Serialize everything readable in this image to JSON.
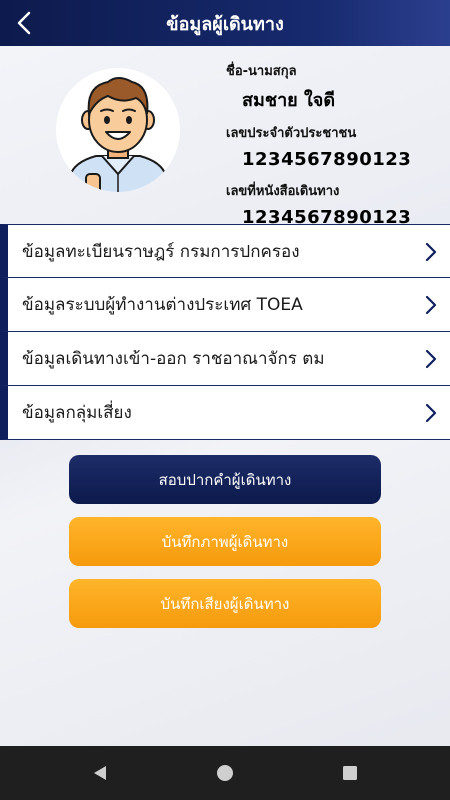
{
  "header": {
    "title": "ข้อมูลผู้เดินทาง"
  },
  "profile": {
    "name_label": "ชื่อ-นามสกุล",
    "name_value": "สมชาย ใจดี",
    "id_label": "เลขประจำตัวประชาชน",
    "id_value": "1234567890123",
    "passport_label": "เลขที่หนังสือเดินทาง",
    "passport_value": "1234567890123"
  },
  "menu": {
    "items": [
      {
        "label": "ข้อมูลทะเบียนราษฎร์ กรมการปกครอง"
      },
      {
        "label": "ข้อมูลระบบผู้ทำงานต่างประเทศ TOEA"
      },
      {
        "label": "ข้อมูลเดินทางเข้า-ออก ราชอาณาจักร ตม"
      },
      {
        "label": "ข้อมูลกลุ่มเสี่ยง"
      }
    ]
  },
  "actions": {
    "interview_label": "สอบปากคำผู้เดินทาง",
    "photo_label": "บันทึกภาพผู้เดินทาง",
    "audio_label": "บันทึกเสียงผู้เดินทาง"
  },
  "colors": {
    "primary": "#0f1f5e",
    "accent": "#f8a318",
    "navbar": "#1f1f1f"
  },
  "icons": {
    "back": "chevron-left-icon",
    "menu_arrow": "chevron-right-icon",
    "avatar": "man-avatar-icon",
    "nav": [
      "nav-back-icon",
      "nav-home-icon",
      "nav-recents-icon"
    ]
  }
}
